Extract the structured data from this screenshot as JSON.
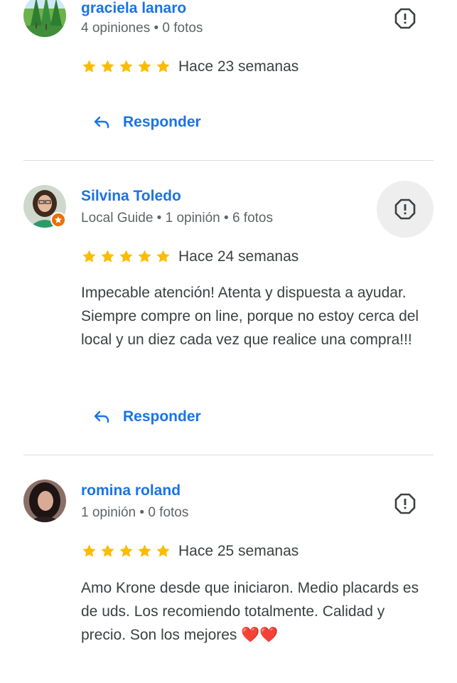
{
  "reviews": [
    {
      "name": "graciela lanaro",
      "meta": "4 opiniones • 0 fotos",
      "rating": 5,
      "time": "Hace 23 semanas",
      "text": "",
      "reply_label": "Responder",
      "avatar_icon": "forest-avatar"
    },
    {
      "name": "Silvina Toledo",
      "meta": "Local Guide • 1 opinión • 6 fotos",
      "rating": 5,
      "time": "Hace 24 semanas",
      "text": "Impecable atención! Atenta y dispuesta a ayudar. Siempre compre on line, porque no estoy cerca del local y un diez cada vez que realice una compra!!!",
      "reply_label": "Responder",
      "avatar_icon": "person-photo-avatar",
      "local_guide": true
    },
    {
      "name": "romina roland",
      "meta": "1 opinión • 0 fotos",
      "rating": 5,
      "time": "Hace 25 semanas",
      "text": "Amo Krone desde que iniciaron. Medio placards es de uds. Los recomiendo totalmente. Calidad y precio. Son los mejores ❤️❤️",
      "avatar_icon": "person-photo-avatar"
    }
  ],
  "colors": {
    "link": "#1a73e8",
    "star": "#fbbc04",
    "secondary": "#5f6368",
    "guide_badge": "#e8710a"
  }
}
